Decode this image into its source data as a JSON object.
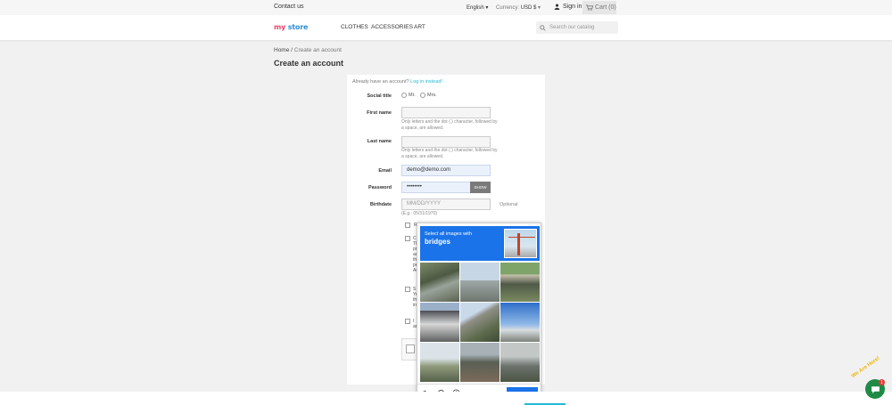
{
  "topbar": {
    "contact": "Contact us",
    "language": "English",
    "currency_label": "Currency:",
    "currency_value": "USD $",
    "signin": "Sign in",
    "cart": "Cart (0)"
  },
  "header": {
    "logo_my": "my",
    "logo_store": "store",
    "nav": [
      "CLOTHES",
      "ACCESSORIES",
      "ART"
    ],
    "search_placeholder": "Search our catalog"
  },
  "breadcrumb": {
    "home": "Home",
    "separator": "/",
    "current": "Create an account"
  },
  "page_title": "Create an account",
  "form": {
    "already": "Already have an account?",
    "login_link": "Log in instead!",
    "social_title_label": "Social title",
    "social_options": [
      "Mr.",
      "Mrs."
    ],
    "first_name_label": "First name",
    "first_name_hint": "Only letters and the dot (.) character, followed by a space, are allowed.",
    "last_name_label": "Last name",
    "last_name_hint": "Only letters and the dot (.) character, followed by a space, are allowed.",
    "email_label": "Email",
    "email_value": "demo@demo.com",
    "password_label": "Password",
    "password_value": "••••••••",
    "show_button": "SHOW",
    "birthdate_label": "Birthdate",
    "birthdate_placeholder": "MM/DD/YYYY",
    "birthdate_hint": "(E.g.: 05/31/1970)",
    "optional": "Optional",
    "checkboxes": [
      {
        "text": "R"
      },
      {
        "text": "C\nThe p\nprivac\nacces\nthe rig\nperso\nAccou"
      },
      {
        "text": "S\nYou m\nthat p\ninfo in"
      },
      {
        "text": "I\nand th"
      }
    ]
  },
  "captcha": {
    "instruction": "Select all images with",
    "target": "bridges",
    "verify": "VERIFY"
  },
  "chat": {
    "label": "We Are Here!",
    "badge": "1"
  },
  "colors": {
    "accent": "#24b9d7",
    "captcha_blue": "#1a73e8",
    "chat_green": "#1f8a45"
  }
}
